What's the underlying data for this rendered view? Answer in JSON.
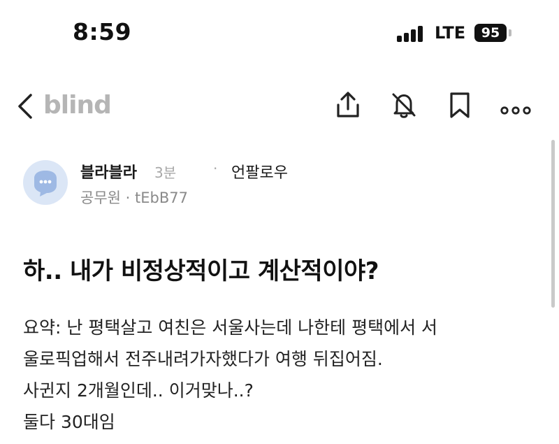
{
  "status_bar": {
    "time": "8:59",
    "network": "LTE",
    "battery": "95"
  },
  "nav": {
    "logo": "blind"
  },
  "author": {
    "name": "블라블라",
    "time_ago": "3분",
    "separator": "·",
    "follow_label": "언팔로우",
    "meta": "공무원 · tEbB77"
  },
  "post": {
    "title": "하.. 내가 비정상적이고 계산적이야?",
    "lines": [
      "요약: 난 평택살고 여친은 서울사는데 나한테 평택에서 서",
      "울로픽업해서 전주내려가자했다가 여행 뒤집어짐.",
      "사귄지 2개월인데.. 이거맞나..?",
      "둘다 30대임"
    ]
  }
}
